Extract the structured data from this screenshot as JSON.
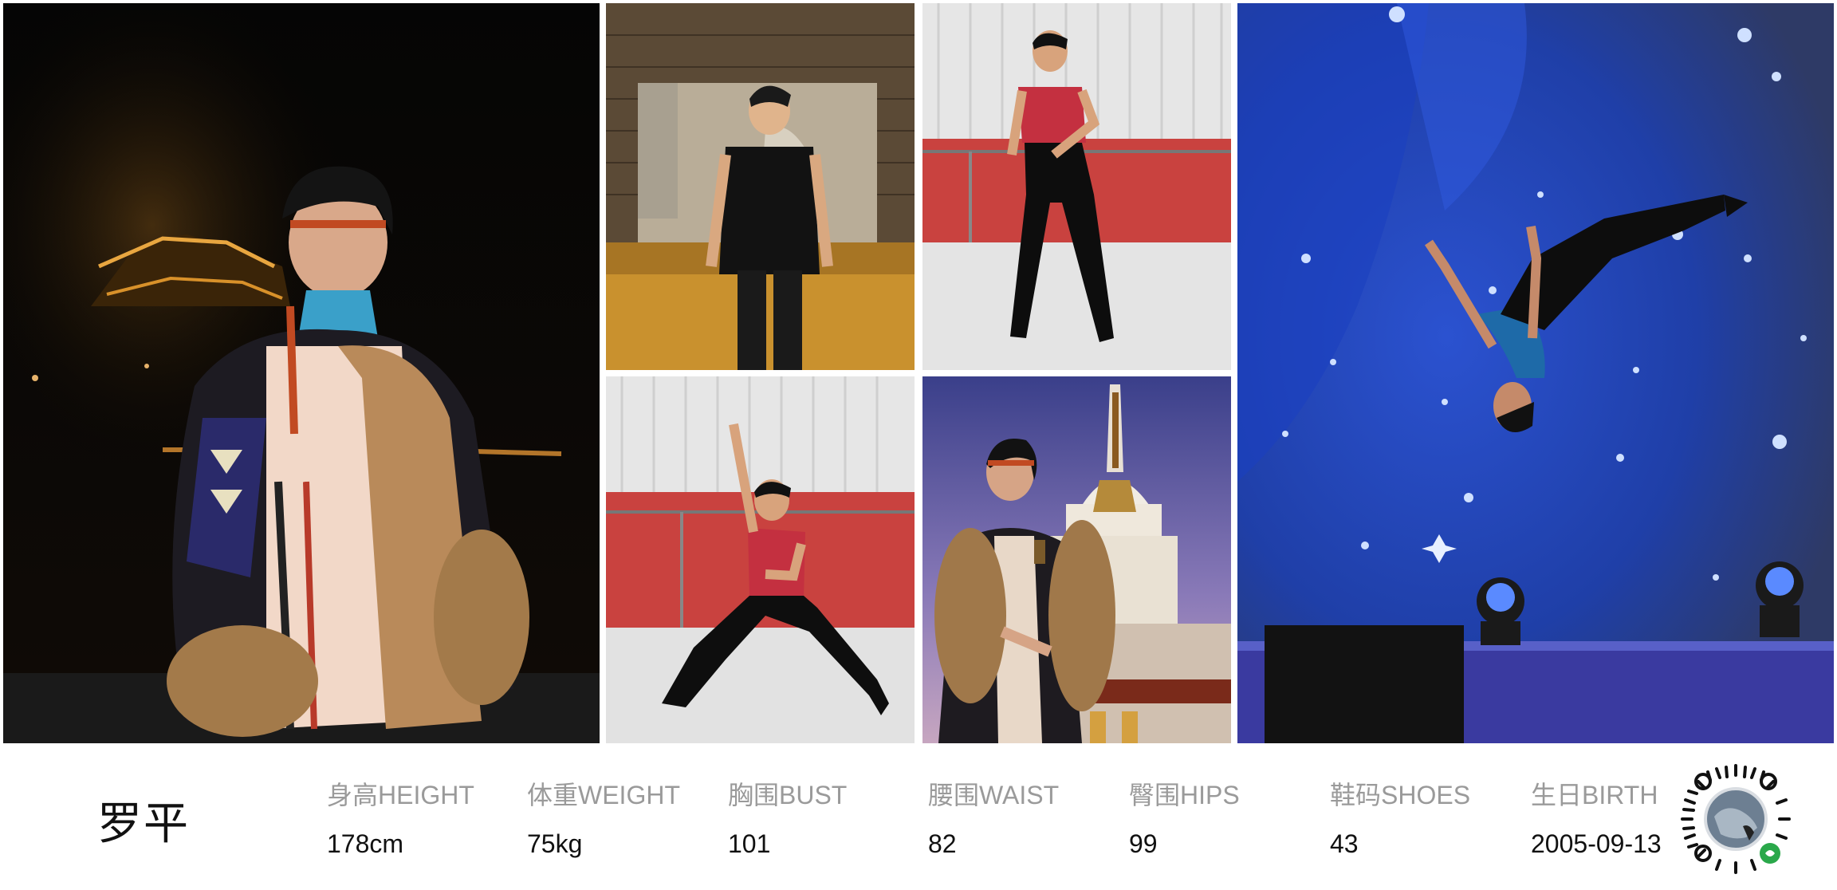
{
  "profile": {
    "name": "罗平",
    "stats": [
      {
        "label": "身高HEIGHT",
        "value": "178cm"
      },
      {
        "label": "体重WEIGHT",
        "value": "75kg"
      },
      {
        "label": "胸围BUST",
        "value": "101"
      },
      {
        "label": "腰围WAIST",
        "value": "82"
      },
      {
        "label": "臀围HIPS",
        "value": "99"
      },
      {
        "label": "鞋码SHOES",
        "value": "43"
      },
      {
        "label": "生日BIRTH",
        "value": "2005-09-13"
      }
    ]
  },
  "photos": [
    {
      "subject": "tibetan-costume-night-portrait"
    },
    {
      "subject": "black-tshirt-mural-wall"
    },
    {
      "subject": "ballet-first-position-studio"
    },
    {
      "subject": "lunge-pose-studio"
    },
    {
      "subject": "costume-stupa-portrait"
    },
    {
      "subject": "stage-leap-starry-backdrop"
    }
  ],
  "colors": {
    "label_gray": "#9a9a9a",
    "value_black": "#111111",
    "studio_red": "#c9423f",
    "stage_blue": "#1f3fa8"
  },
  "icons": {
    "qr": "mini-program-qr-icon"
  }
}
